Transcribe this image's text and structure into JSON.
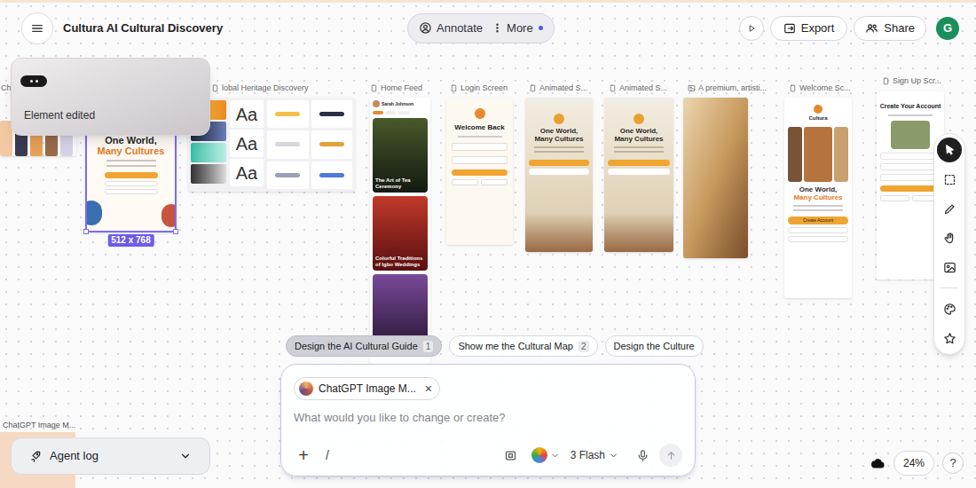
{
  "app": {
    "title": "Cultura AI Cultural Discovery"
  },
  "header": {
    "annotate": "Annotate",
    "more": "More",
    "export": "Export",
    "share": "Share",
    "avatar": "G"
  },
  "toast": {
    "message": "Element edited"
  },
  "frames": [
    {
      "kind": "thumbs",
      "label": "Ch",
      "selected": false
    },
    {
      "kind": "welcome",
      "selected": true,
      "size": "512 x 768",
      "brand": "Cultura",
      "headline": "One World,",
      "accent": "Many Cultures"
    },
    {
      "kind": "design",
      "label": "lobal Heritage Discovery",
      "selected": false,
      "samples": [
        "Aa",
        "Aa",
        "Aa"
      ]
    },
    {
      "kind": "feed",
      "label": "Home Feed",
      "selected": false,
      "user": "Sarah Johnson",
      "cards": [
        "The Art of Tea Ceremony",
        "Colorful Traditions of Igbo Weddings"
      ]
    },
    {
      "kind": "login",
      "label": "Login Screen",
      "selected": false,
      "title": "Welcome Back"
    },
    {
      "kind": "hero",
      "label": "Animated S...",
      "selected": false,
      "headline": "One World,",
      "accent": "Many Cultures"
    },
    {
      "kind": "hero",
      "label": "Animated S...",
      "selected": false,
      "headline": "One World,",
      "accent": "Many Cultures"
    },
    {
      "kind": "photo",
      "label": "A premium, artisti...",
      "selected": false
    },
    {
      "kind": "welcome-long",
      "label": "Welcome Sc...",
      "selected": false,
      "brand": "Cultura",
      "headline": "One World,",
      "accent": "Many Cultures",
      "button": "Create Account"
    },
    {
      "kind": "signup",
      "label": "Sign Up Scr...",
      "selected": false,
      "title": "Create Your Account"
    }
  ],
  "tools": [
    {
      "kind": "pointer",
      "selected": true
    },
    {
      "kind": "marquee",
      "selected": false
    },
    {
      "kind": "pencil",
      "selected": false
    },
    {
      "kind": "hand",
      "selected": false
    },
    {
      "kind": "image",
      "selected": false
    },
    {
      "kind": "palette",
      "selected": false
    },
    {
      "kind": "star",
      "selected": false
    }
  ],
  "suggestions": [
    {
      "label": "Design the AI Cultural Guide",
      "count": "1",
      "selected": true
    },
    {
      "label": "Show me the Cultural Map",
      "count": "2",
      "selected": false
    },
    {
      "label": "Design the Culture",
      "selected": false
    }
  ],
  "prompt": {
    "attachment": "ChatGPT Image M...",
    "remove": "×",
    "placeholder": "What would you like to change or create?",
    "plus": "+",
    "slash": "/",
    "model": "3 Flash"
  },
  "canvas_caption": "ChatGPT Image M...",
  "agent_log": {
    "label": "Agent log",
    "expanded": false
  },
  "zoom": "24%",
  "help": "?"
}
